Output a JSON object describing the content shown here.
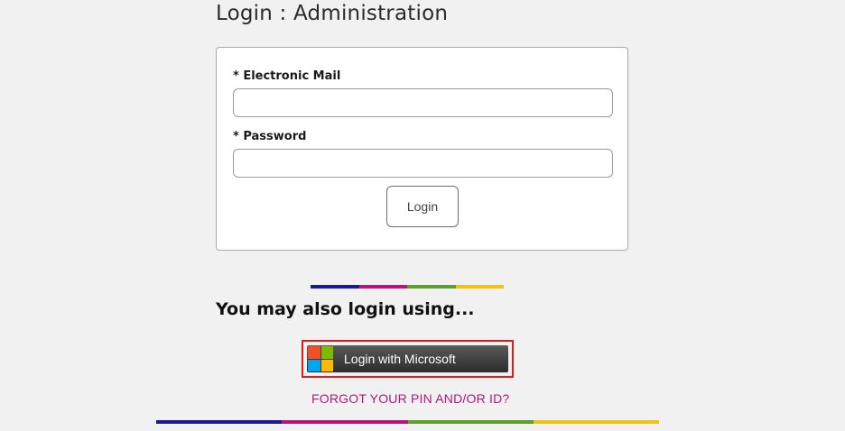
{
  "page": {
    "title": "Login : Administration"
  },
  "login_form": {
    "email_label": "* Electronic Mail",
    "email_value": "",
    "password_label": "* Password",
    "password_value": "",
    "login_button": "Login"
  },
  "alternate_login": {
    "heading": "You may also login using...",
    "microsoft_button": "Login with Microsoft",
    "microsoft_logo_colors": [
      "#f25022",
      "#7fba00",
      "#00a4ef",
      "#ffb900"
    ]
  },
  "forgot_link": "FORGOT YOUR PIN AND/OR ID?",
  "theme": {
    "accent_bar_colors": [
      "#1c1b8c",
      "#b5167d",
      "#5d9e2f",
      "#f2c317"
    ],
    "link_color": "#b5167d",
    "highlight_outline": "#e01b1b"
  }
}
